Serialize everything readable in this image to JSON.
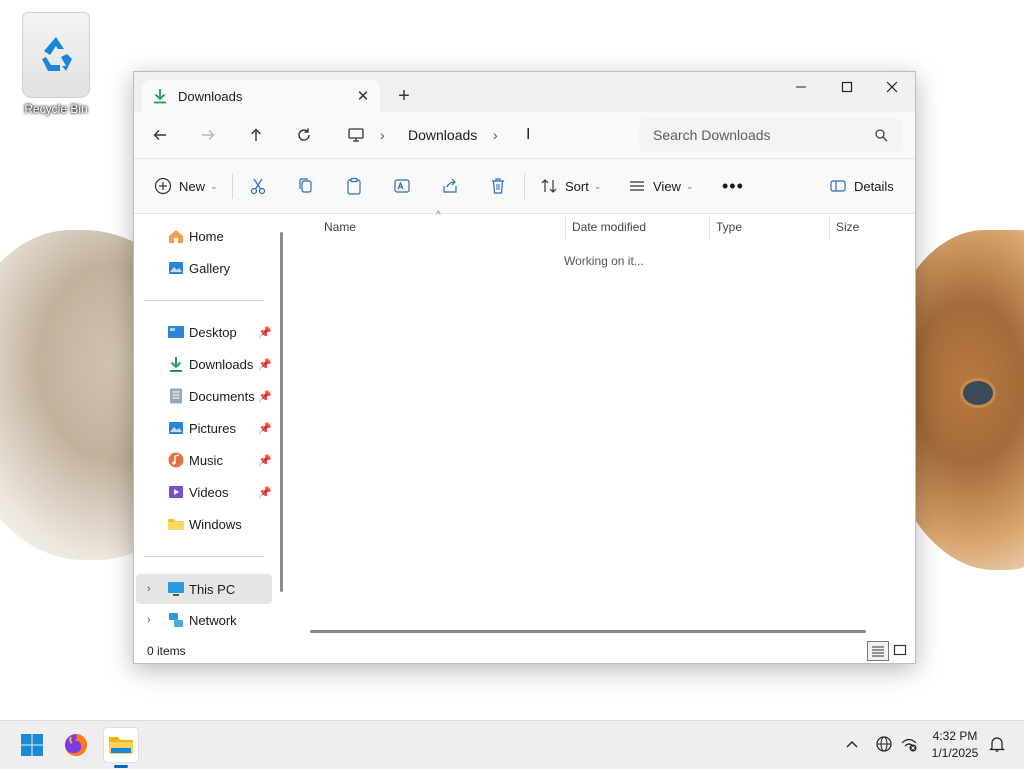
{
  "desktop": {
    "icons": [
      {
        "label": "Recycle Bin"
      }
    ]
  },
  "window": {
    "tab": {
      "title": "Downloads"
    },
    "address": {
      "breadcrumb": [
        "Downloads"
      ],
      "search_placeholder": "Search Downloads"
    },
    "toolbar": {
      "new_label": "New",
      "sort_label": "Sort",
      "view_label": "View",
      "details_label": "Details"
    },
    "sidebar": {
      "quick": [
        {
          "label": "Home",
          "icon": "home-icon"
        },
        {
          "label": "Gallery",
          "icon": "gallery-icon"
        }
      ],
      "pinned": [
        {
          "label": "Desktop",
          "icon": "desktop-folder-icon",
          "pinned": true
        },
        {
          "label": "Downloads",
          "icon": "downloads-folder-icon",
          "pinned": true
        },
        {
          "label": "Documents",
          "icon": "documents-folder-icon",
          "pinned": true
        },
        {
          "label": "Pictures",
          "icon": "pictures-folder-icon",
          "pinned": true
        },
        {
          "label": "Music",
          "icon": "music-folder-icon",
          "pinned": true
        },
        {
          "label": "Videos",
          "icon": "videos-folder-icon",
          "pinned": true
        },
        {
          "label": "Windows",
          "icon": "folder-icon",
          "pinned": false
        }
      ],
      "tree": [
        {
          "label": "This PC",
          "icon": "this-pc-icon",
          "selected": true
        },
        {
          "label": "Network",
          "icon": "network-icon",
          "selected": false
        }
      ]
    },
    "columns": [
      "Name",
      "Date modified",
      "Type",
      "Size"
    ],
    "content_status": "Working on it...",
    "status_bar": {
      "item_count": "0 items"
    }
  },
  "taskbar": {
    "apps": [
      "start-icon",
      "firefox-icon",
      "file-explorer-icon"
    ],
    "clock": {
      "time": "4:32 PM",
      "date": "1/1/2025"
    }
  },
  "colors": {
    "accent": "#0067c0",
    "download_green": "#1f9d55",
    "folder_yellow": "#f4c542"
  }
}
